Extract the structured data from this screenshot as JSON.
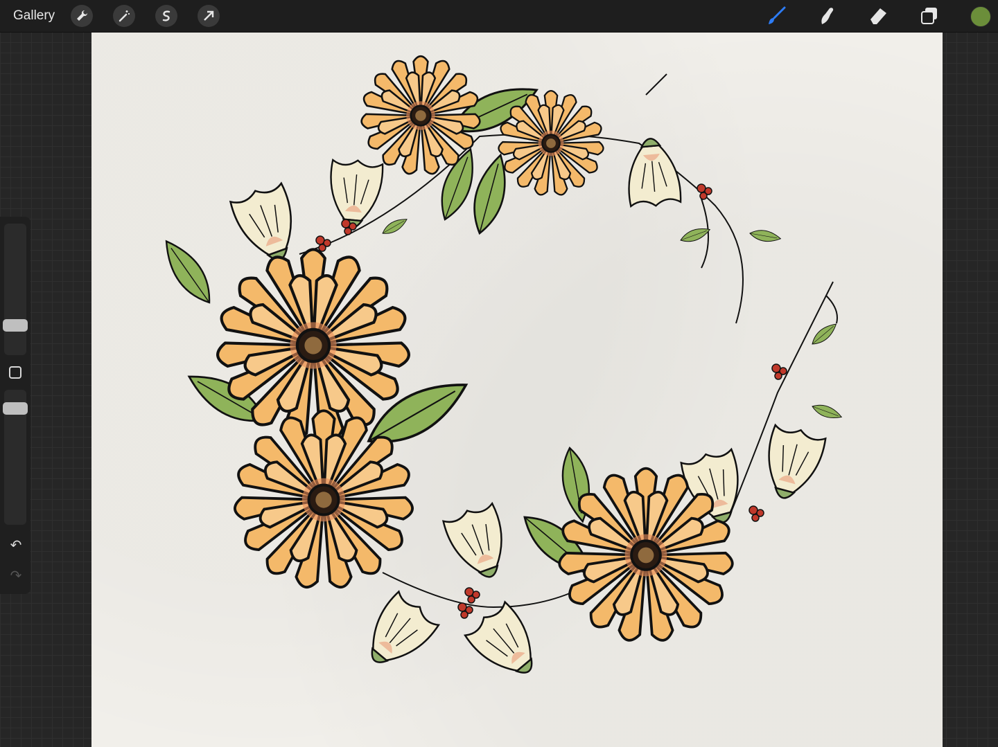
{
  "topbar": {
    "gallery_label": "Gallery",
    "left_tools": [
      "wrench-icon",
      "magic-wand-icon",
      "selection-icon",
      "transform-arrow-icon"
    ],
    "right_tools": [
      "brush-icon",
      "smudge-icon",
      "eraser-icon",
      "layers-icon"
    ],
    "active_tool": "brush-icon",
    "current_color": "#6b8e3a",
    "accent_color": "#2d7cf6"
  },
  "sidebar": {
    "brush_size_level": 0.35,
    "opacity_level": 0.9,
    "undo_icon": "undo-icon",
    "redo_icon": "redo-icon",
    "modify_icon": "square-modify-icon"
  },
  "artwork": {
    "subject": "floral-wreath",
    "colors": {
      "petal": "#f4b96a",
      "petal_blush": "#e98e5a",
      "leaf": "#8fb35a",
      "bell": "#f3ecd0",
      "berry": "#c0392b",
      "ink": "#111111"
    }
  }
}
